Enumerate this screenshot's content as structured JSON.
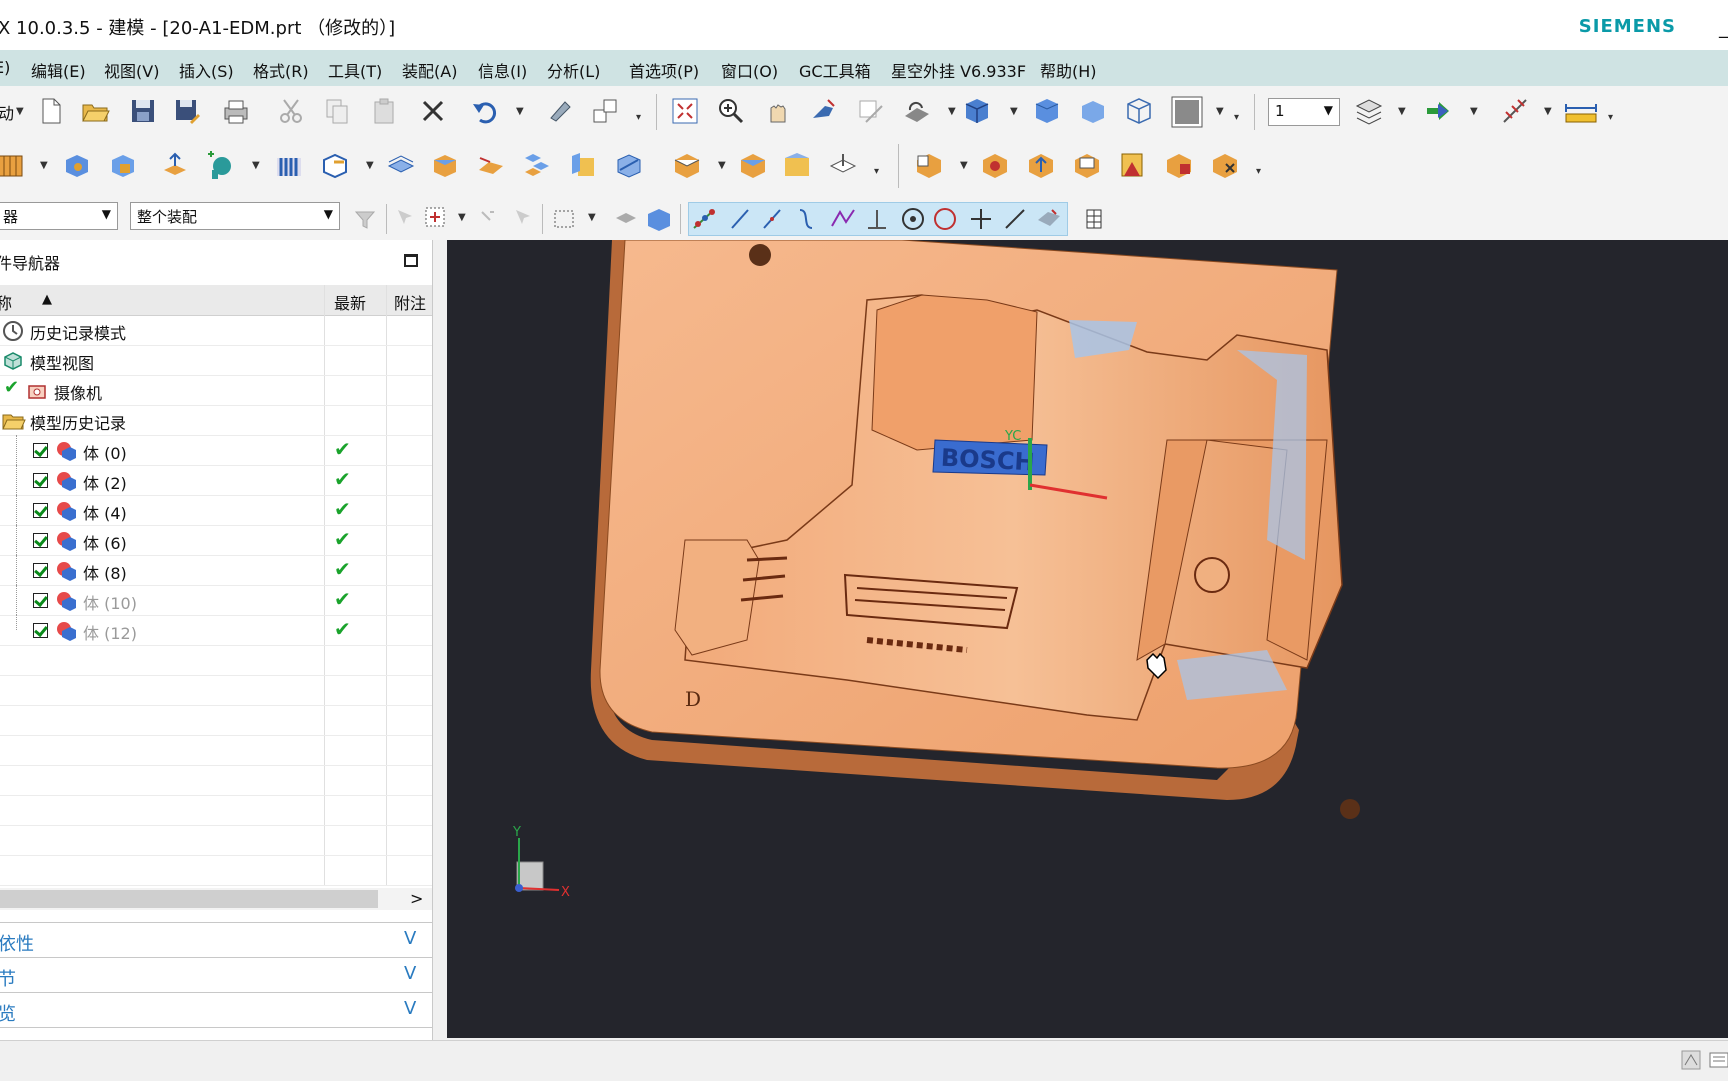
{
  "window": {
    "title": "X 10.0.3.5 - 建模 - [20-A1-EDM.prt （修改的）]",
    "brand": "SIEMENS",
    "min_glyph": "_"
  },
  "menu": [
    "E)",
    "编辑(E)",
    "视图(V)",
    "插入(S)",
    "格式(R)",
    "工具(T)",
    "装配(A)",
    "信息(I)",
    "分析(L)",
    "首选项(P)",
    "窗口(O)",
    "GC工具箱",
    "星空外挂 V6.933F",
    "帮助(H)"
  ],
  "toolbar1": {
    "left_label": "动",
    "layer_value": "1"
  },
  "toolbar3": {
    "filter_value": "器",
    "scope_value": "整个装配"
  },
  "navigator": {
    "title": "件导航器",
    "columns": {
      "name": "称",
      "latest": "最新",
      "note": "附注"
    },
    "rows": [
      {
        "label": "历史记录模式",
        "icon": "clock-icon",
        "latest": ""
      },
      {
        "label": "模型视图",
        "icon": "model-views-icon",
        "latest": ""
      },
      {
        "label": "摄像机",
        "icon": "camera-icon",
        "latest": ""
      },
      {
        "label": "模型历史记录",
        "icon": "folder-open-icon",
        "latest": ""
      },
      {
        "label": "体 (0)",
        "icon": "body-icon",
        "latest": "✔",
        "dim": false
      },
      {
        "label": "体 (2)",
        "icon": "body-icon",
        "latest": "✔",
        "dim": false
      },
      {
        "label": "体 (4)",
        "icon": "body-icon",
        "latest": "✔",
        "dim": false
      },
      {
        "label": "体 (6)",
        "icon": "body-icon",
        "latest": "✔",
        "dim": false
      },
      {
        "label": "体 (8)",
        "icon": "body-icon",
        "latest": "✔",
        "dim": false
      },
      {
        "label": "体 (10)",
        "icon": "body-icon",
        "latest": "✔",
        "dim": true
      },
      {
        "label": "体 (12)",
        "icon": "body-icon",
        "latest": "✔",
        "dim": true
      }
    ],
    "scroll_right": ">"
  },
  "panels": [
    {
      "label": "依性",
      "chevron": "V"
    },
    {
      "label": "节",
      "chevron": "V"
    },
    {
      "label": "览",
      "chevron": "V"
    }
  ],
  "viewport": {
    "model_text": "BOSCH",
    "corner_mark": "D",
    "wcs_label": "YC",
    "triad": {
      "y": "Y",
      "x": "X"
    }
  },
  "colors": {
    "menu_bg": "#cfe3e3",
    "brand": "#0a9aa8",
    "viewport_bg": "#24252c",
    "model": "#f0a06a",
    "link": "#2a7bc0"
  }
}
